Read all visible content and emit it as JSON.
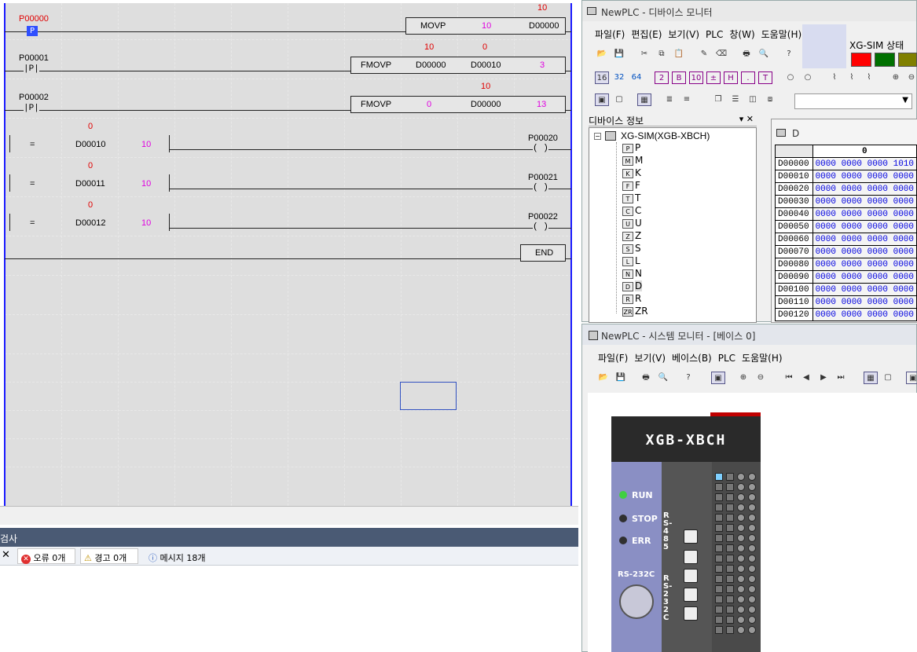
{
  "ladder": {
    "rung0": {
      "contact": "P00000",
      "value_top": "10",
      "func": "MOVP",
      "src": "10",
      "dst": "D00000"
    },
    "rung1": {
      "contact": "P00001",
      "v1": "10",
      "v2": "0",
      "func": "FMOVP",
      "a": "D00000",
      "b": "D00010",
      "c": "3"
    },
    "rung2": {
      "contact": "P00002",
      "value_top": "10",
      "func": "FMOVP",
      "a": "0",
      "b": "D00000",
      "c": "13"
    },
    "rung3": {
      "cur": "0",
      "op": "=",
      "a": "D00010",
      "b": "10",
      "coil": "P00020"
    },
    "rung4": {
      "cur": "0",
      "op": "=",
      "a": "D00011",
      "b": "10",
      "coil": "P00021"
    },
    "rung5": {
      "cur": "0",
      "op": "=",
      "a": "D00012",
      "b": "10",
      "coil": "P00022"
    },
    "end": "END",
    "contact_sym": "—|P|—",
    "coil_sym": "( )"
  },
  "messages": {
    "title": "검사",
    "close": "✕",
    "errors": "오류 0개",
    "warnings": "경고 0개",
    "info": "메시지 18개"
  },
  "device_monitor": {
    "title": "NewPLC - 디바이스 모니터",
    "menu": [
      "파일(F)",
      "편집(E)",
      "보기(V)",
      "PLC",
      "창(W)",
      "도움말(H)"
    ],
    "sim_status": "XG-SIM 상태",
    "status_colors": [
      "#ff0000",
      "#007000",
      "#808000"
    ],
    "radix": [
      "16",
      "32",
      "64"
    ],
    "tree_title": "디바이스 정보",
    "tree_root": "XG-SIM(XGB-XBCH)",
    "tree_items": [
      "P",
      "M",
      "K",
      "F",
      "T",
      "C",
      "U",
      "Z",
      "S",
      "L",
      "N",
      "D",
      "R",
      "ZR"
    ],
    "table_title": "D",
    "col_header": "0",
    "rows": [
      {
        "addr": "D00000",
        "val": "0000 0000 0000 1010"
      },
      {
        "addr": "D00010",
        "val": "0000 0000 0000 0000"
      },
      {
        "addr": "D00020",
        "val": "0000 0000 0000 0000"
      },
      {
        "addr": "D00030",
        "val": "0000 0000 0000 0000"
      },
      {
        "addr": "D00040",
        "val": "0000 0000 0000 0000"
      },
      {
        "addr": "D00050",
        "val": "0000 0000 0000 0000"
      },
      {
        "addr": "D00060",
        "val": "0000 0000 0000 0000"
      },
      {
        "addr": "D00070",
        "val": "0000 0000 0000 0000"
      },
      {
        "addr": "D00080",
        "val": "0000 0000 0000 0000"
      },
      {
        "addr": "D00090",
        "val": "0000 0000 0000 0000"
      },
      {
        "addr": "D00100",
        "val": "0000 0000 0000 0000"
      },
      {
        "addr": "D00110",
        "val": "0000 0000 0000 0000"
      },
      {
        "addr": "D00120",
        "val": "0000 0000 0000 0000"
      }
    ]
  },
  "system_monitor": {
    "title": "NewPLC - 시스템 모니터 - [베이스 0]",
    "menu": [
      "파일(F)",
      "보기(V)",
      "베이스(B)",
      "PLC",
      "도움말(H)"
    ],
    "plc_name": "XGB-XBCH",
    "leds": [
      "RUN",
      "STOP",
      "ERR"
    ],
    "led_colors": [
      "#40d040",
      "#303030",
      "#303030"
    ],
    "rs485": "RS-485",
    "rs232": "RS-232C",
    "port_label": "RS-232C"
  }
}
